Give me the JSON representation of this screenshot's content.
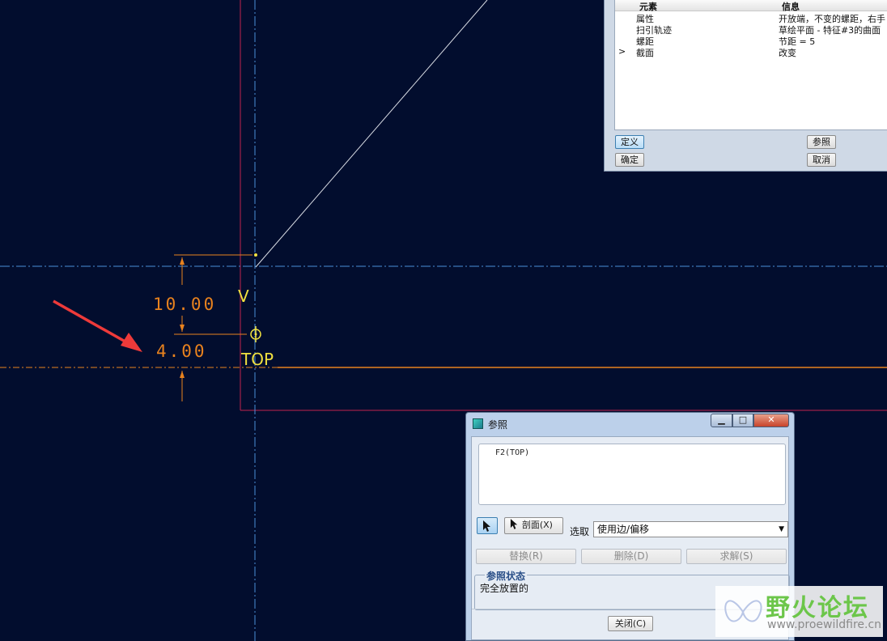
{
  "sketch": {
    "dim_upper": "10.00",
    "dim_lower": "4.00",
    "ref_v": "V",
    "ref_top": "TOP"
  },
  "feature_dialog": {
    "col_element": "元素",
    "col_info": "信息",
    "rows": [
      {
        "expander": "",
        "element": "属性",
        "info": "开放端，不变的螺距，右手"
      },
      {
        "expander": "",
        "element": "扫引轨迹",
        "info": "草绘平面 - 特征#3的曲面"
      },
      {
        "expander": "",
        "element": "螺距",
        "info": "节距 = 5"
      },
      {
        "expander": ">",
        "element": "截面",
        "info": "改变"
      }
    ],
    "btn_define": "定义",
    "btn_ref": "参照",
    "btn_ok": "确定",
    "btn_cancel": "取消"
  },
  "ref_dialog": {
    "title": "参照",
    "min": "▁",
    "max": "□",
    "close": "✕",
    "list_item": "F2(TOP)",
    "btn_section": "剖面(X)",
    "select_label": "选取",
    "select_value": "使用边/偏移",
    "btn_replace": "替换(R)",
    "btn_delete": "删除(D)",
    "btn_solve": "求解(S)",
    "status_title": "参照状态",
    "status_text": "完全放置的",
    "btn_close": "关闭(C)"
  },
  "watermark": {
    "title": "野火论坛",
    "url": "www.proewildfire.cn"
  },
  "colors": {
    "background": "#020d2e",
    "dimension": "#e8821e",
    "reference": "#f0e040",
    "annotation_arrow": "#ee3a3a",
    "border": "#c0224e",
    "centerline": "#4a90d8"
  }
}
